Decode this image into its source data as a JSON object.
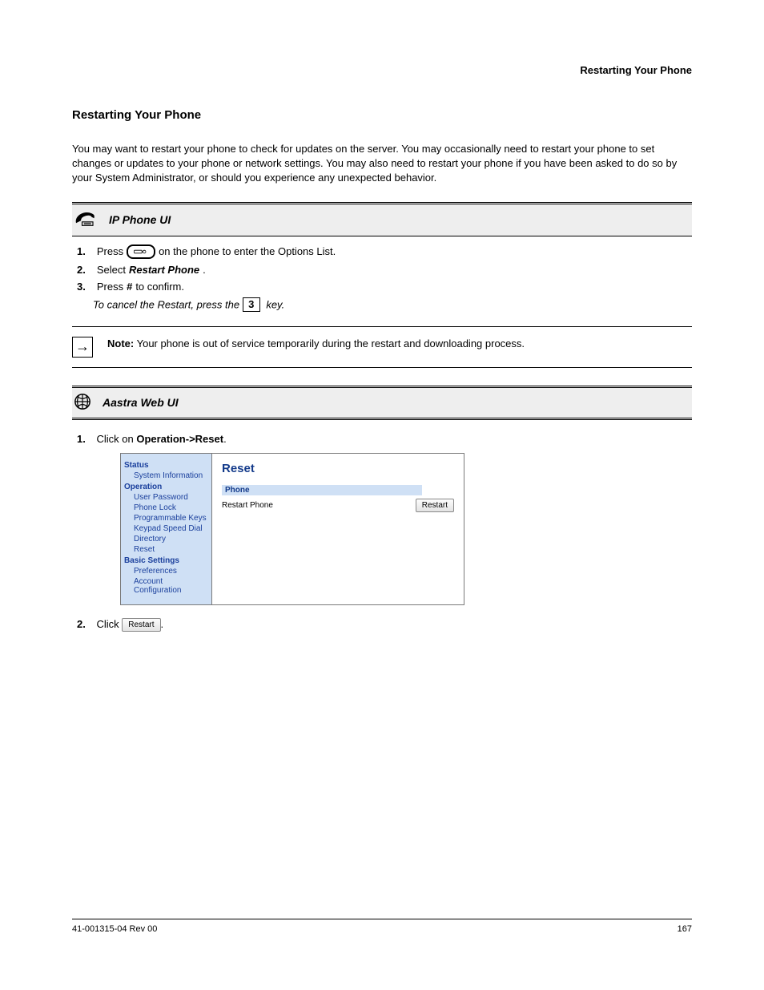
{
  "header_right": "Restarting Your Phone",
  "section_title": "Restarting Your Phone",
  "intro": "You may want to restart your phone to check for updates on the server. You may occasionally need to restart your phone to set changes or updates to your phone or network settings. You may also need to restart your phone if you have been asked to do so by your System Administrator, or should you experience any unexpected behavior.",
  "phone_bar_label": "IP Phone UI",
  "web_bar_label": "Aastra Web UI",
  "steps_phone": {
    "s1_pre": "Press",
    "s1_post": "on the phone to enter the Options List.",
    "s2_a": "Select",
    "s2_restart": "Restart Phone",
    "s3_a": "Press",
    "s3_hash": "#",
    "s3_b": "to confirm.",
    "note": "To cancel the Restart, press the",
    "note_cancel": "3",
    "note_tail": "key."
  },
  "note_label": "Note:",
  "note_body": "Your phone is out of service temporarily during the restart and downloading process.",
  "web_steps": {
    "s1": "Click on",
    "s1_bold": "Operation->Reset",
    "s2_pre": "Click",
    "s2_post": "."
  },
  "webui": {
    "panel_title": "Reset",
    "sub_head": "Phone",
    "row_label": "Restart Phone",
    "button": "Restart",
    "sidebar": {
      "g1": "Status",
      "g1_items": [
        "System Information"
      ],
      "g2": "Operation",
      "g2_items": [
        "User Password",
        "Phone Lock",
        "Programmable Keys",
        "Keypad Speed Dial",
        "Directory",
        "Reset"
      ],
      "g3": "Basic Settings",
      "g3_items": [
        "Preferences",
        "Account Configuration"
      ]
    }
  },
  "footer_left": "41-001315-04 Rev 00",
  "footer_right": "167"
}
